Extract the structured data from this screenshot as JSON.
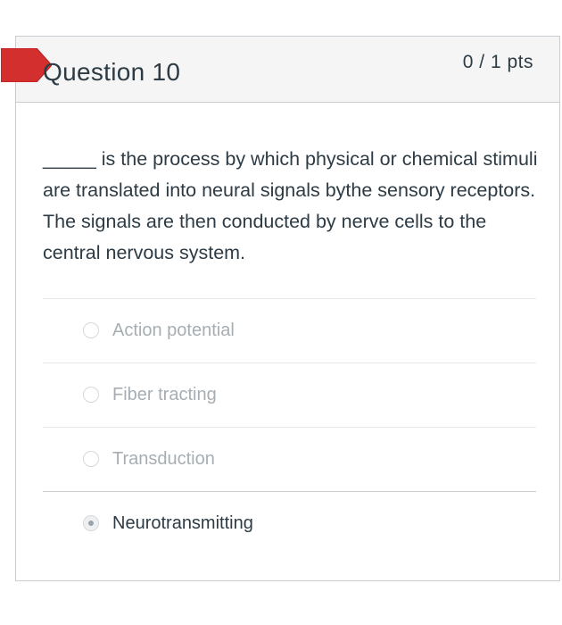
{
  "question": {
    "title": "Question 10",
    "points": "0 / 1 pts",
    "text": "_____ is the process by which physical or chemical stimuli are translated into neural signals bythe sensory receptors. The signals are then conducted by nerve cells to the central nervous system."
  },
  "answers": [
    {
      "label": "Action potential",
      "selected": false
    },
    {
      "label": "Fiber tracting",
      "selected": false
    },
    {
      "label": "Transduction",
      "selected": false
    },
    {
      "label": "Neurotransmitting",
      "selected": true
    }
  ],
  "colors": {
    "flag": "#d32f2f",
    "header_bg": "#f5f5f5",
    "border": "#c7cdd1",
    "text": "#2d3b45",
    "muted_text": "#a7aeb3"
  }
}
